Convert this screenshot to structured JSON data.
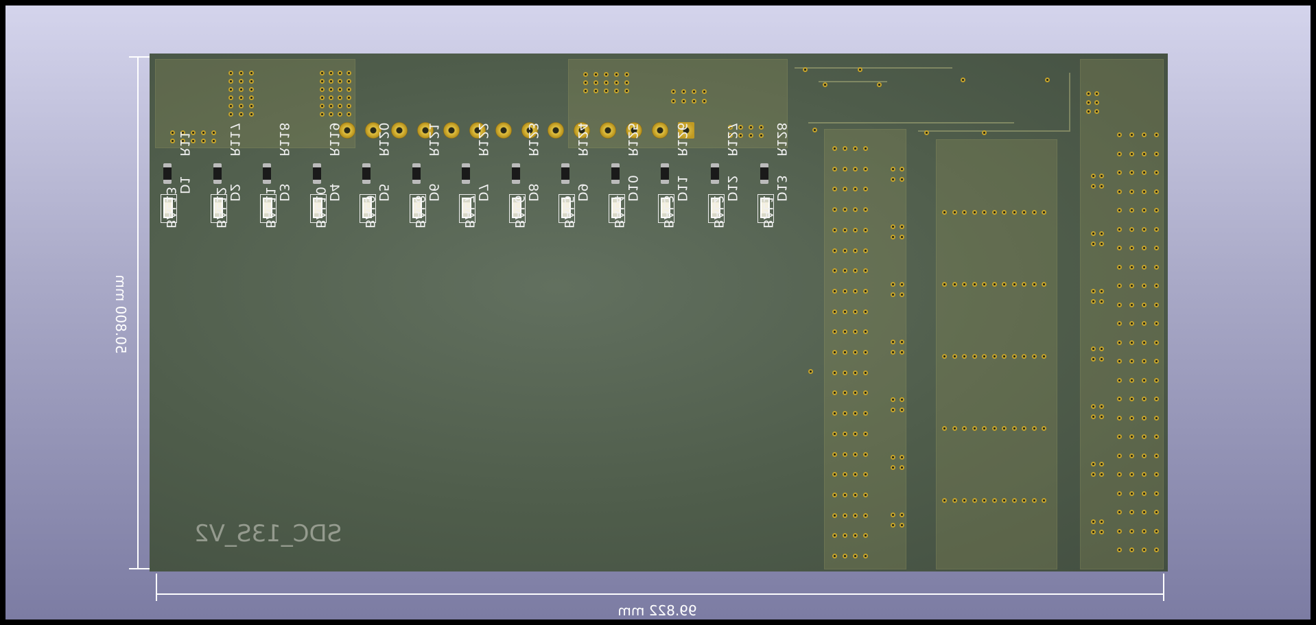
{
  "viewer": {
    "background_top": "#d4d4ec",
    "background_bottom": "#7c7ca3",
    "board_color": "#4f5d4b",
    "copper_color": "#c7a42a"
  },
  "dimensions": {
    "width_label": "99.822 mm",
    "height_label": "50.800 mm"
  },
  "board": {
    "silkscreen_label": "SDC_13S_V2"
  },
  "components": [
    {
      "ref": "R11",
      "led": "D1",
      "bal": "BAL13"
    },
    {
      "ref": "R117",
      "led": "D2",
      "bal": "BAL12"
    },
    {
      "ref": "R118",
      "led": "D3",
      "bal": "BAL11"
    },
    {
      "ref": "R119",
      "led": "D4",
      "bal": "BAL10"
    },
    {
      "ref": "R120",
      "led": "D5",
      "bal": "BAL9"
    },
    {
      "ref": "R121",
      "led": "D6",
      "bal": "BAL8"
    },
    {
      "ref": "R122",
      "led": "D7",
      "bal": "BAL7"
    },
    {
      "ref": "R123",
      "led": "D8",
      "bal": "BAL6"
    },
    {
      "ref": "R124",
      "led": "D9",
      "bal": "BAL5"
    },
    {
      "ref": "R125",
      "led": "D10",
      "bal": "BAL4"
    },
    {
      "ref": "R126",
      "led": "D11",
      "bal": "BAL3"
    },
    {
      "ref": "R127",
      "led": "D12",
      "bal": "BAL2"
    },
    {
      "ref": "R128",
      "led": "D13",
      "bal": "BAL1"
    }
  ],
  "header_pins": 14
}
